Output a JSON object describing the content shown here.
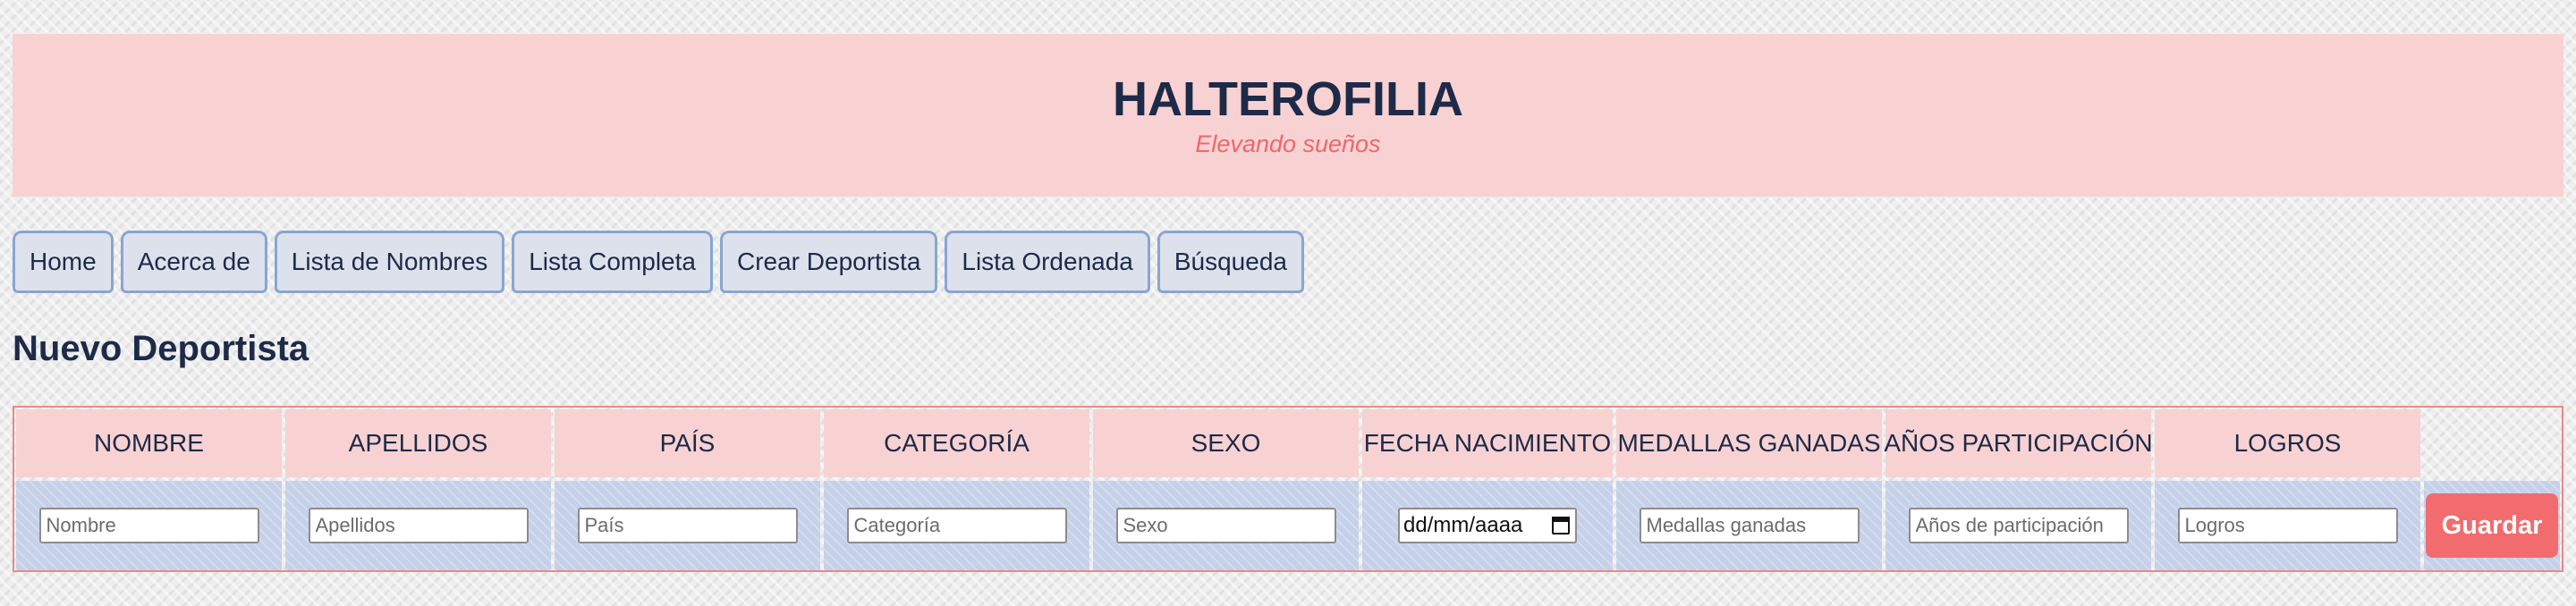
{
  "header": {
    "title": "HALTEROFILIA",
    "subtitle": "Elevando sueños"
  },
  "nav": {
    "tabs": [
      {
        "label": "Home"
      },
      {
        "label": "Acerca de"
      },
      {
        "label": "Lista de Nombres"
      },
      {
        "label": "Lista Completa"
      },
      {
        "label": "Crear Deportista"
      },
      {
        "label": "Lista Ordenada"
      },
      {
        "label": "Búsqueda"
      }
    ]
  },
  "section": {
    "title": "Nuevo Deportista"
  },
  "form": {
    "columns": [
      {
        "header": "NOMBRE",
        "placeholder": "Nombre"
      },
      {
        "header": "APELLIDOS",
        "placeholder": "Apellidos"
      },
      {
        "header": "PAÍS",
        "placeholder": "País"
      },
      {
        "header": "CATEGORÍA",
        "placeholder": "Categoría"
      },
      {
        "header": "SEXO",
        "placeholder": "Sexo"
      },
      {
        "header": "FECHA NACIMIENTO",
        "placeholder": "dd/mm/aaaa"
      },
      {
        "header": "MEDALLAS GANADAS",
        "placeholder": "Medallas ganadas"
      },
      {
        "header": "AÑOS PARTICIPACIÓN",
        "placeholder": "Años de participación"
      },
      {
        "header": "LOGROS",
        "placeholder": "Logros"
      }
    ],
    "save_label": "Guardar"
  },
  "colors": {
    "header_bg": "#f8d2d2",
    "accent": "#f26b6e",
    "text": "#1d2a48",
    "nav_border": "#8aa5d0",
    "input_row_bg": "#c5d0e9"
  }
}
